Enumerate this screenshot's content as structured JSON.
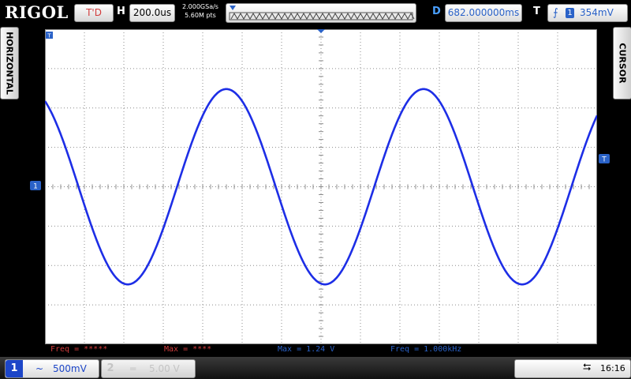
{
  "brand": {
    "logo": "RIGOL"
  },
  "top_bar": {
    "trigger_status": "T'D",
    "horizontal_label": "H",
    "timebase": "200.0us",
    "sample_rate": "2.000GSa/s",
    "memory_depth": "5.60M pts",
    "delay_label": "D",
    "delay_value": "682.000000ms",
    "trigger_label": "T",
    "trigger_source": "1",
    "trigger_level": "354mV"
  },
  "side_tabs": {
    "left": "HORIZONTAL",
    "right": "CURSOR"
  },
  "markers": {
    "trigger_position": "T",
    "channel_ground": "1",
    "trigger_level_marker": "T"
  },
  "measurements": [
    {
      "label": "Freq = *****",
      "color": "#d23c3c"
    },
    {
      "label": "Max = ****",
      "color": "#d23c3c"
    },
    {
      "label": "Max = 1.24 V",
      "color": "#2a62c8"
    },
    {
      "label": "Freq = 1.000kHz",
      "color": "#2a62c8"
    }
  ],
  "channels": [
    {
      "number": "1",
      "coupling": "~",
      "scale": "500mV",
      "active": true,
      "color": "#1d46c8"
    },
    {
      "number": "2",
      "coupling": "═",
      "scale": "5.00 V",
      "active": false,
      "color": "#c4c4c4"
    }
  ],
  "status": {
    "usb_icon": "usb-icon",
    "time": "16:16"
  },
  "waveform": {
    "channel": "1",
    "shape": "sine",
    "color": "#1d2ee6",
    "frequency_hz": 1000,
    "peak_v": 1.24,
    "volts_per_div": 0.5,
    "time_per_div_us": 200,
    "grid": {
      "h_divs": 14,
      "v_divs": 8
    }
  },
  "theme": {
    "grid_color": "#8c8c8c",
    "screen_bg": "#ffffff"
  }
}
